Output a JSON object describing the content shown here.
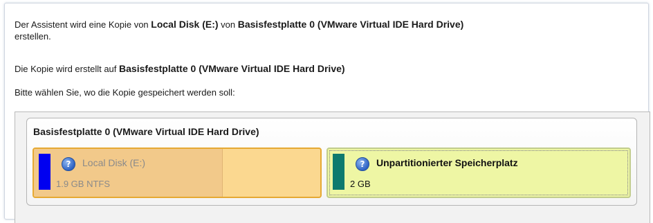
{
  "info": {
    "line1_pre": "Der Assistent wird eine Kopie von",
    "source_partition": "Local Disk (E:)",
    "line1_mid": "von",
    "source_disk": "Basisfestplatte 0 (VMware Virtual IDE Hard Drive)",
    "line1_post": "erstellen.",
    "line2_pre": "Die Kopie wird erstellt auf",
    "target_disk": "Basisfestplatte 0 (VMware Virtual IDE Hard Drive)",
    "line3": "Bitte wählen Sie, wo die Kopie gespeichert werden soll:"
  },
  "disk": {
    "title": "Basisfestplatte 0 (VMware Virtual IDE Hard Drive)",
    "partitions": [
      {
        "name": "Local Disk (E:)",
        "size": "1.9 GB NTFS",
        "icon": "question-icon",
        "swatch_color": "#0000f0",
        "enabled": false,
        "selected": false
      },
      {
        "name": "Unpartitionierter Speicherplatz",
        "size": "2 GB",
        "icon": "question-icon",
        "swatch_color": "#0e7a6e",
        "enabled": true,
        "selected": true
      }
    ]
  },
  "icons": {
    "question": "?"
  }
}
